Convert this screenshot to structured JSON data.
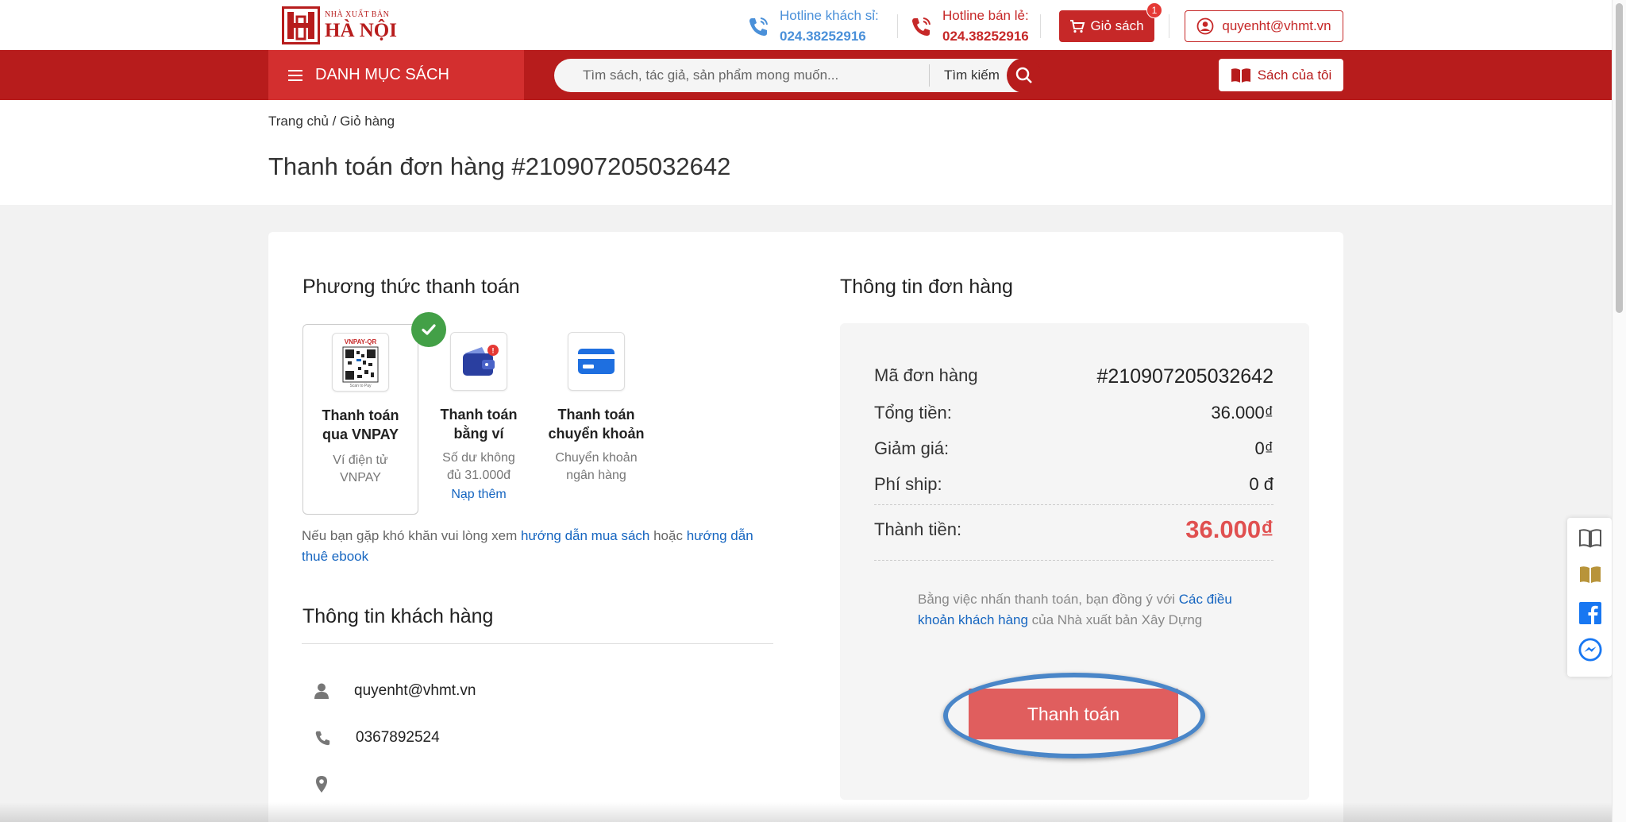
{
  "header": {
    "logo": {
      "small": "NHÀ XUẤT BẢN",
      "big": "HÀ NỘI"
    },
    "hotline_wholesale": {
      "label": "Hotline khách sỉ:",
      "number": "024.38252916"
    },
    "hotline_retail": {
      "label": "Hotline bán lẻ:",
      "number": "024.38252916"
    },
    "cart": {
      "label": "Giỏ sách",
      "count": "1"
    },
    "user": {
      "email": "quyenht@vhmt.vn"
    }
  },
  "nav": {
    "category_label": "DANH MỤC SÁCH",
    "search_placeholder": "Tìm sách, tác giả, sản phẩm mong muốn...",
    "search_button": "Tìm kiếm",
    "my_books": "Sách của tôi"
  },
  "breadcrumb": "Trang chủ / Giỏ hàng",
  "page_title": "Thanh toán đơn hàng #210907205032642",
  "payment": {
    "heading": "Phương thức thanh toán",
    "options": [
      {
        "title_line1": "Thanh toán",
        "title_line2": "qua VNPAY",
        "desc_line1": "Ví điện tử",
        "desc_line2": "VNPAY",
        "icon": "vnpay-qr-icon",
        "selected": true
      },
      {
        "title_line1": "Thanh toán",
        "title_line2": "bằng ví",
        "desc_line1": "Số dư không",
        "desc_line2": "đủ 31.000đ",
        "link": "Nạp thêm",
        "icon": "wallet-icon"
      },
      {
        "title_line1": "Thanh toán",
        "title_line2": "chuyển khoản",
        "desc_line1": "Chuyển khoản",
        "desc_line2": "ngân hàng",
        "icon": "credit-card-icon"
      }
    ],
    "help_prefix": "Nếu bạn gặp khó khăn vui lòng xem ",
    "help_link1": "hướng dẫn mua sách",
    "help_mid": " hoặc ",
    "help_link2": "hướng dẫn thuê ebook"
  },
  "customer": {
    "heading": "Thông tin khách hàng",
    "email": "quyenht@vhmt.vn",
    "phone": "0367892524",
    "address": ""
  },
  "order": {
    "heading": "Thông tin đơn hàng",
    "code_label": "Mã đơn hàng",
    "code_value": "#210907205032642",
    "total_label": "Tổng tiền:",
    "total_value": "36.000₫",
    "discount_label": "Giảm giá:",
    "discount_value": "0₫",
    "shipping_label": "Phí ship:",
    "shipping_value": "0 đ",
    "grand_label": "Thành tiền:",
    "grand_value": "36.000₫",
    "agree_prefix": "Bằng việc nhấn thanh toán, bạn đồng ý với ",
    "agree_link": "Các điều khoản khách hàng",
    "agree_suffix": " của Nhà xuất bản Xây Dựng",
    "pay_button": "Thanh toán"
  },
  "colors": {
    "brand_red": "#b71c1c",
    "accent_red": "#e05050",
    "link_blue": "#1565c0",
    "check_green": "#43a047"
  }
}
